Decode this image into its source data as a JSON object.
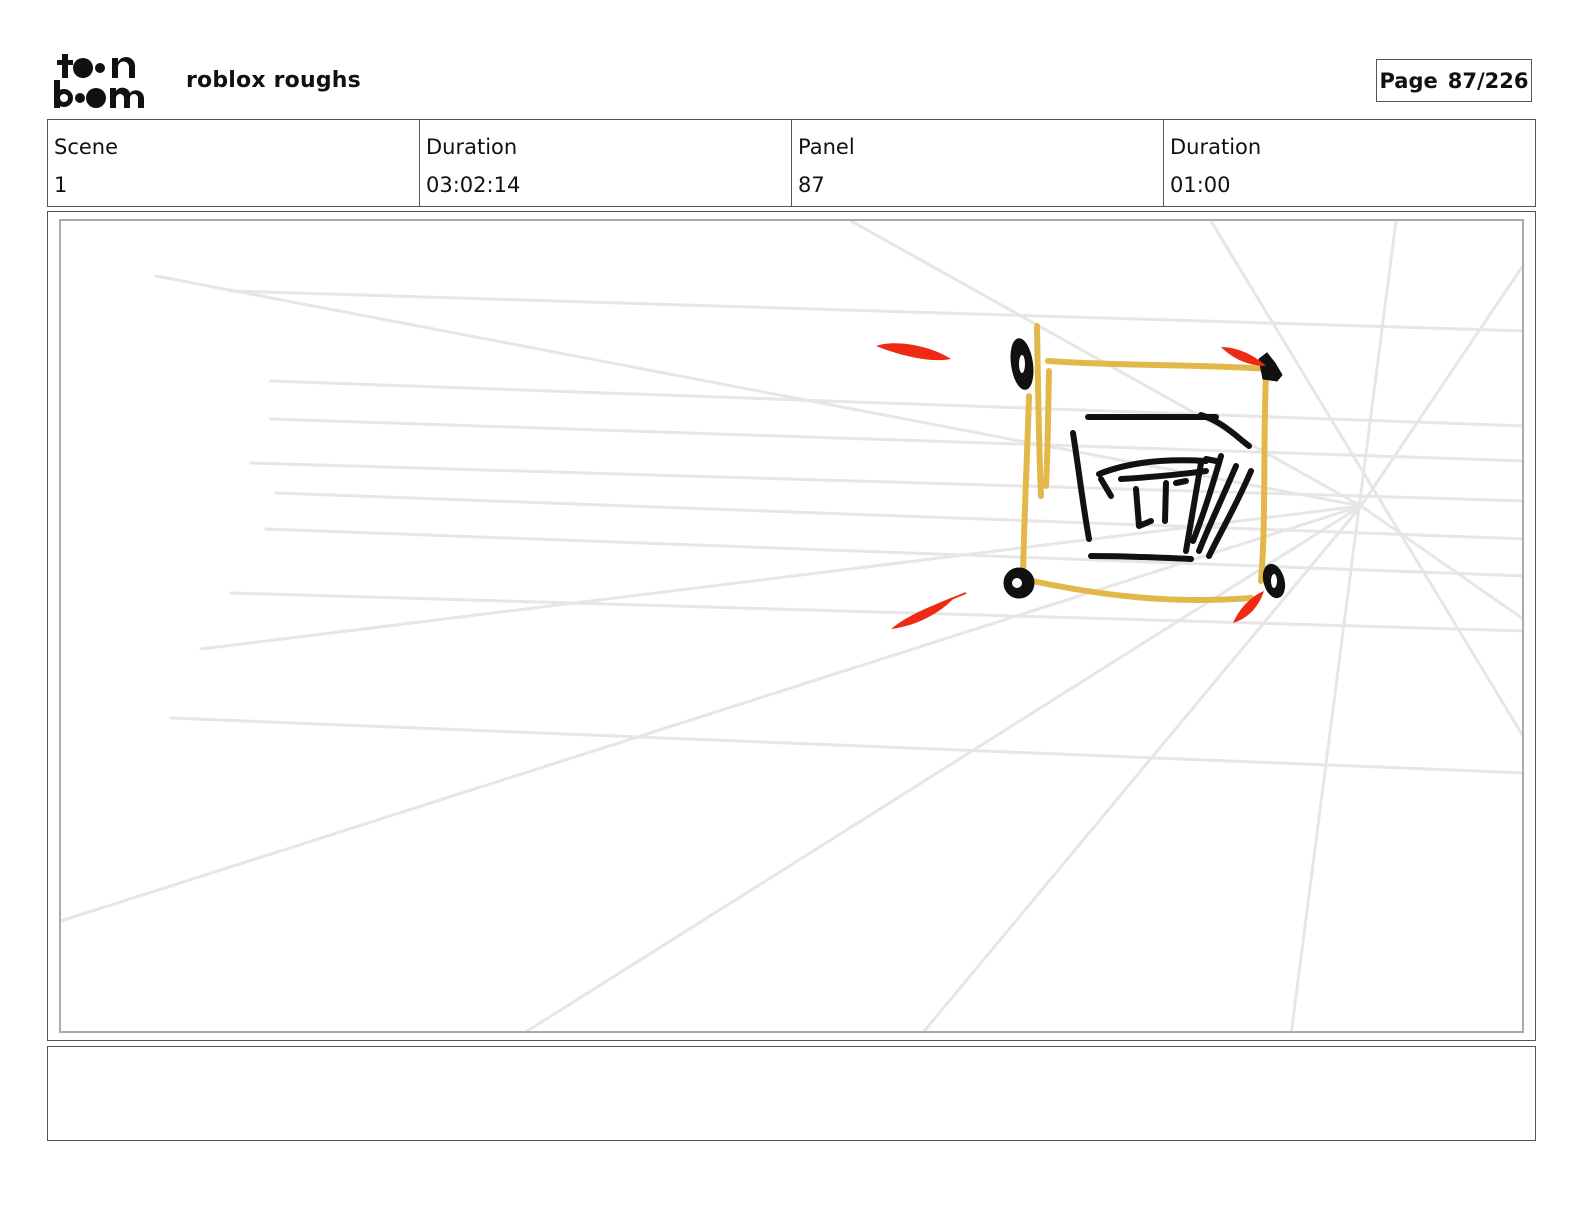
{
  "header": {
    "logo_text": "toonboom",
    "project_title": "roblox roughs",
    "page_label": "Page",
    "page_value": "87/226"
  },
  "info": {
    "scene_label": "Scene",
    "scene_value": "1",
    "scene_duration_label": "Duration",
    "scene_duration_value": "03:02:14",
    "panel_label": "Panel",
    "panel_value": "87",
    "panel_duration_label": "Duration",
    "panel_duration_value": "01:00"
  },
  "drawing": {
    "subject": "rough sketch of a square icon with black dots at corners and red motion strokes",
    "colors": {
      "frame": "#e3b84a",
      "ink": "#111111",
      "accent": "#ee2a14",
      "guides": "#e4e4e4"
    }
  },
  "notes": {
    "text": ""
  }
}
